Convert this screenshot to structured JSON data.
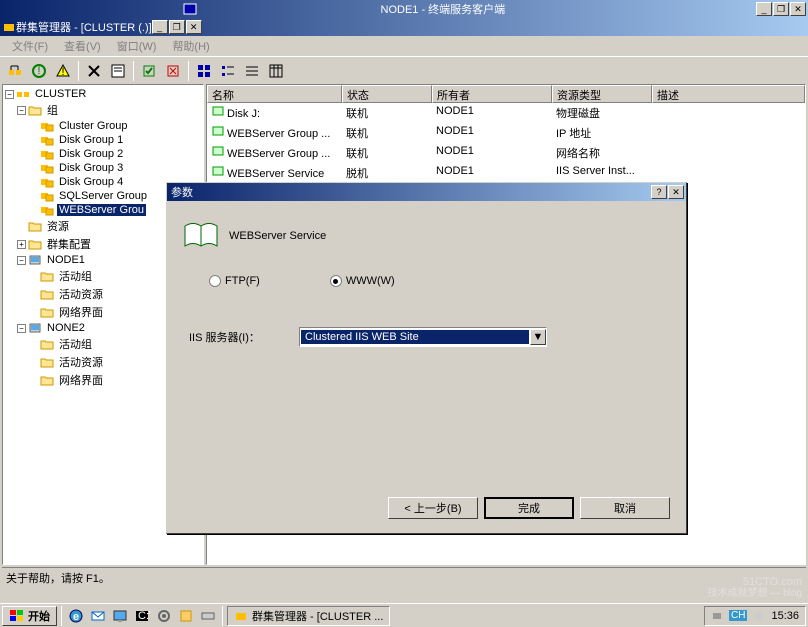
{
  "outerWindow": {
    "title": "NODE1 - 终端服务客户端"
  },
  "innerWindow": {
    "title": "群集管理器 - [CLUSTER (.)]"
  },
  "menu": [
    "文件(F)",
    "查看(V)",
    "窗口(W)",
    "帮助(H)"
  ],
  "tree": {
    "root": "CLUSTER",
    "groupsFolder": "组",
    "groups": [
      "Cluster Group",
      "Disk Group 1",
      "Disk Group 2",
      "Disk Group 3",
      "Disk Group 4",
      "SQLServer Group",
      "WEBServer Grou"
    ],
    "resources": "资源",
    "config": "群集配置",
    "node1": {
      "name": "NODE1",
      "items": [
        "活动组",
        "活动资源",
        "网络界面"
      ]
    },
    "node2": {
      "name": "NONE2",
      "items": [
        "活动组",
        "活动资源",
        "网络界面"
      ]
    }
  },
  "list": {
    "headers": [
      "名称",
      "状态",
      "所有者",
      "资源类型",
      "描述"
    ],
    "rows": [
      {
        "name": "Disk J:",
        "status": "联机",
        "owner": "NODE1",
        "type": "物理磁盘"
      },
      {
        "name": "WEBServer Group ...",
        "status": "联机",
        "owner": "NODE1",
        "type": "IP 地址"
      },
      {
        "name": "WEBServer Group ...",
        "status": "联机",
        "owner": "NODE1",
        "type": "网络名称"
      },
      {
        "name": "WEBServer Service",
        "status": "脱机",
        "owner": "NODE1",
        "type": "IIS Server Inst..."
      }
    ]
  },
  "dialog": {
    "title": "参数",
    "serviceName": "WEBServer Service",
    "radioFtp": "FTP(F)",
    "radioWww": "WWW(W)",
    "fieldLabel": "IIS 服务器(I)：",
    "comboValue": "Clustered IIS WEB Site",
    "btnBack": "< 上一步(B)",
    "btnFinish": "完成",
    "btnCancel": "取消"
  },
  "statusBar": "关于帮助，请按 F1。",
  "taskbar": {
    "start": "开始",
    "task": "群集管理器 - [CLUSTER ...",
    "ime": "CH",
    "time": "15:36"
  },
  "watermark": {
    "main": "51CTO.com",
    "sub": "技术成就梦想 — blog"
  }
}
